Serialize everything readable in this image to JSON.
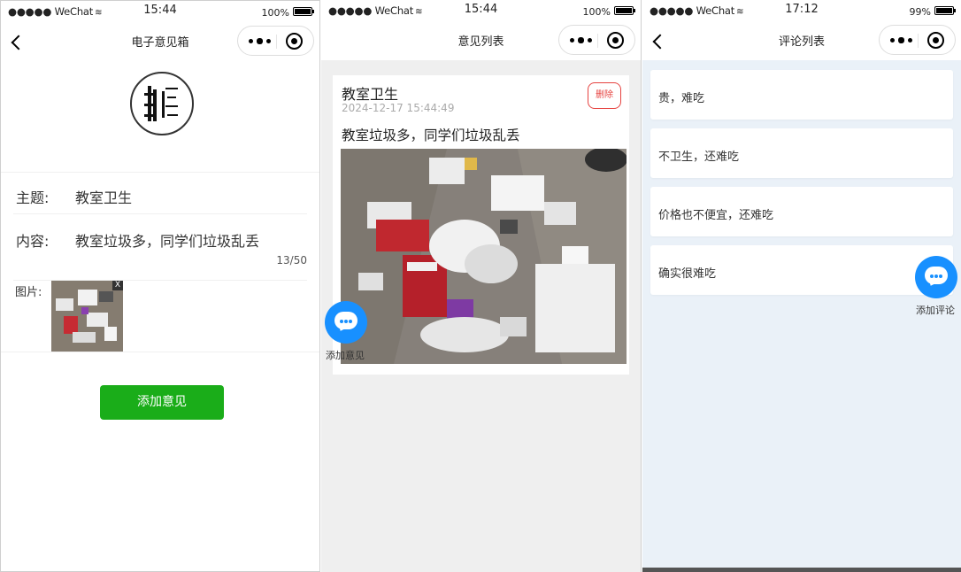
{
  "colors": {
    "wechat_green": "#1aad19",
    "fab_blue": "#1890ff",
    "delete_red": "#e64340"
  },
  "screen1": {
    "status": {
      "carrier": "●●●●● WeChat",
      "time": "15:44",
      "battery": "100%"
    },
    "nav_title": "电子意见箱",
    "form": {
      "subject_label": "主题:",
      "subject_value": "教室卫生",
      "content_label": "内容:",
      "content_value": "教室垃圾多，同学们垃圾乱丢",
      "char_count": "13/50",
      "image_label": "图片:",
      "thumb_remove": "X"
    },
    "submit_label": "添加意见"
  },
  "screen2": {
    "status": {
      "carrier": "●●●●● WeChat",
      "time": "15:44",
      "battery": "100%"
    },
    "nav_title": "意见列表",
    "card": {
      "title": "教室卫生",
      "time": "2024-12-17 15:44:49",
      "delete_label": "删除",
      "content": "教室垃圾多，同学们垃圾乱丢"
    },
    "fab_label": "添加意见"
  },
  "screen3": {
    "status": {
      "carrier": "●●●●● WeChat",
      "time": "17:12",
      "battery": "99%"
    },
    "nav_title": "评论列表",
    "comments": [
      {
        "text": "贵，难吃"
      },
      {
        "text": "不卫生，还难吃"
      },
      {
        "text": "价格也不便宜，还难吃"
      },
      {
        "text": "确实很难吃"
      }
    ],
    "fab_label": "添加评论"
  }
}
